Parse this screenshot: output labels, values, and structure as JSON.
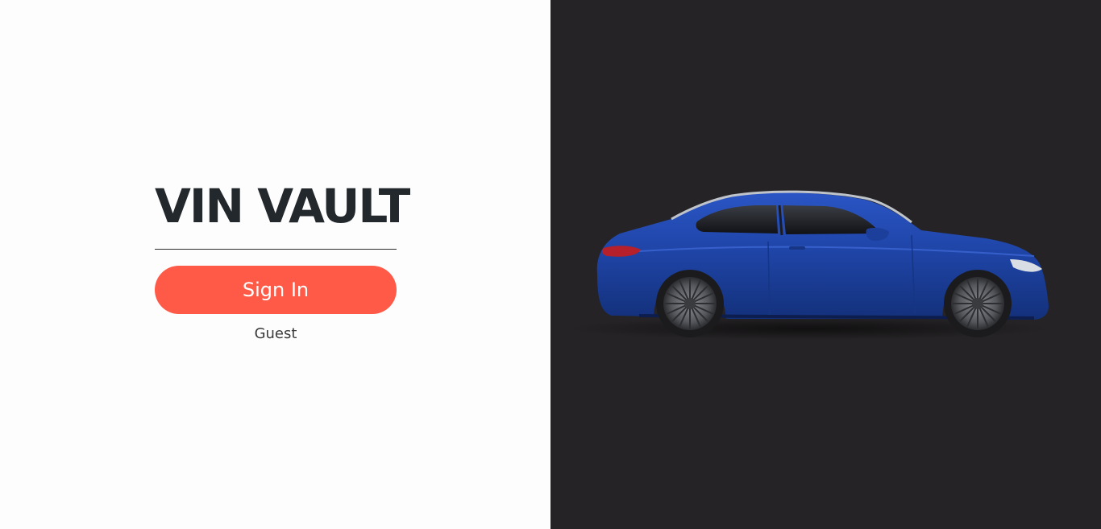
{
  "app": {
    "title": "VIN VAULT"
  },
  "auth": {
    "sign_in_label": "Sign In",
    "guest_label": "Guest"
  },
  "hero": {
    "image_subject": "blue-coupe-car",
    "background_color": "#252325",
    "car_color": "#1f43a3"
  },
  "colors": {
    "accent": "#ff5a48",
    "left_background": "#fdfdfd",
    "title_text": "#23282d"
  }
}
